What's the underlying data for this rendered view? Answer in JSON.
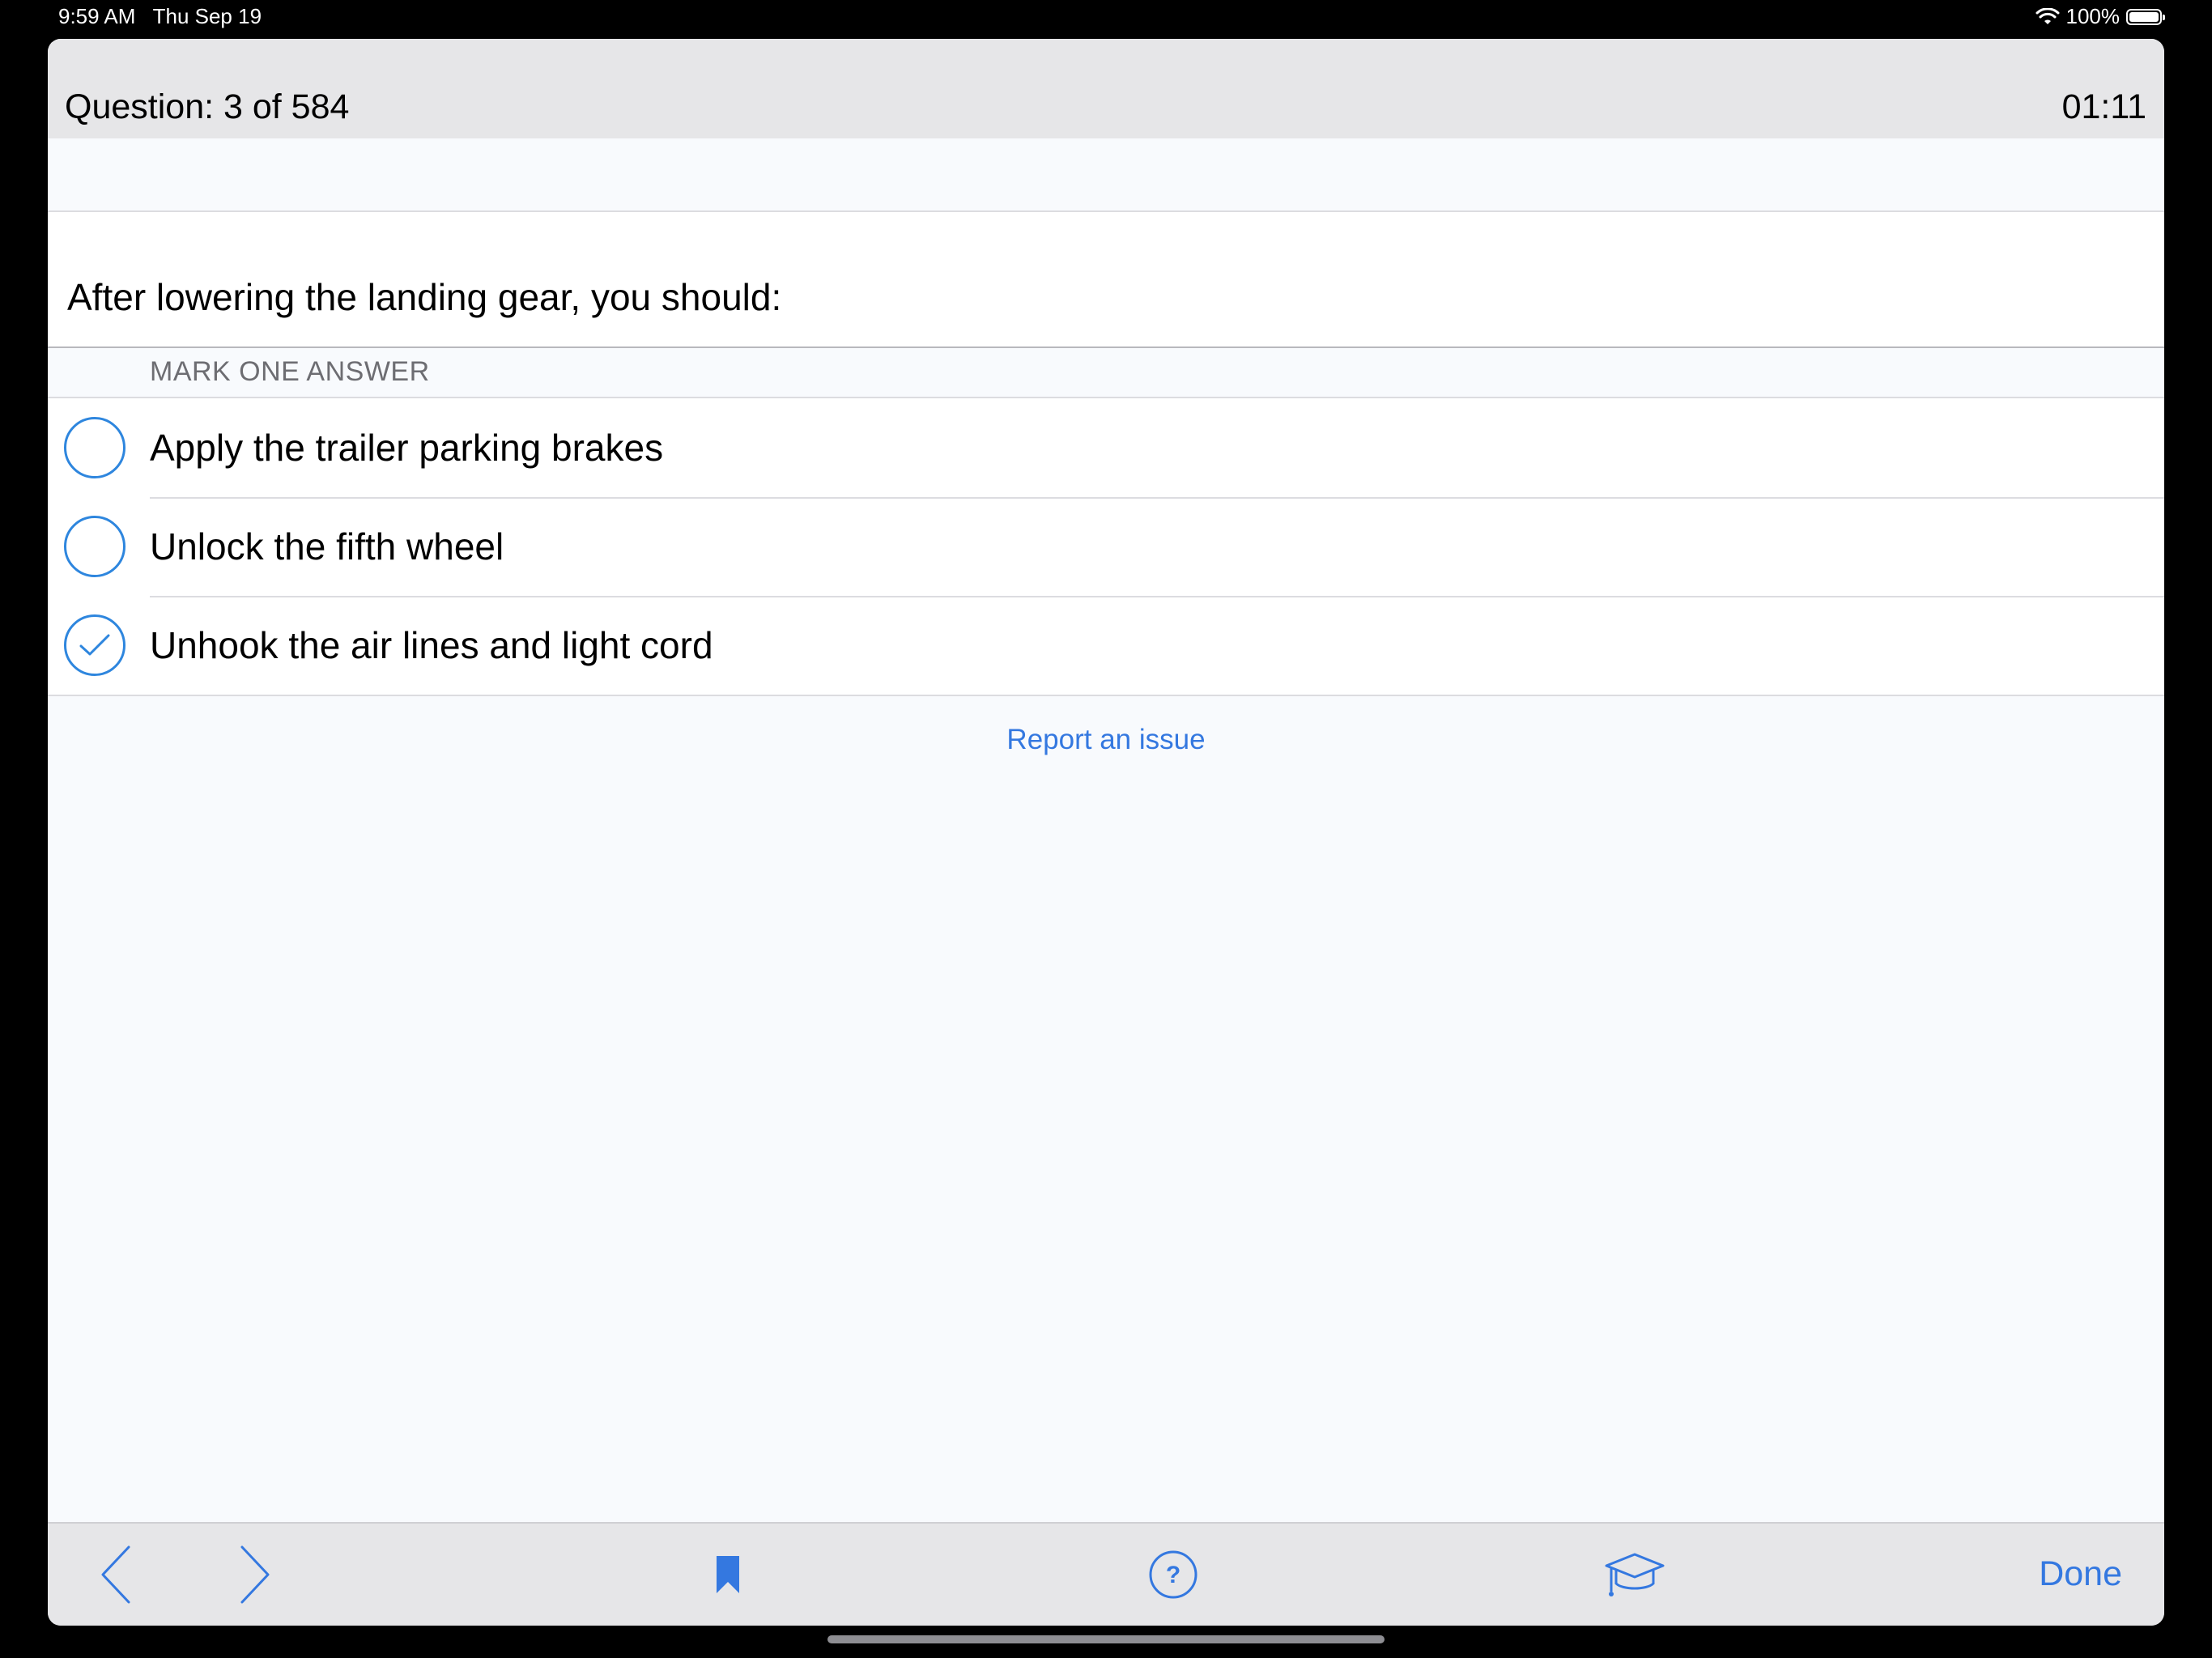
{
  "status_bar": {
    "time": "9:59 AM",
    "date": "Thu Sep 19",
    "battery_text": "100%",
    "wifi_icon": "wifi-icon",
    "battery_icon": "battery-icon"
  },
  "header": {
    "question_counter": "Question: 3 of 584",
    "timer": "01:11"
  },
  "question": {
    "text": "After lowering the landing gear, you should:"
  },
  "answers": {
    "section_label": "MARK ONE ANSWER",
    "options": [
      {
        "label": "Apply the trailer parking brakes",
        "selected": false
      },
      {
        "label": "Unlock the fifth wheel",
        "selected": false
      },
      {
        "label": "Unhook the air lines and light cord",
        "selected": true
      }
    ]
  },
  "report_link": "Report an issue",
  "toolbar": {
    "back_icon": "chevron-left-icon",
    "forward_icon": "chevron-right-icon",
    "bookmark_icon": "bookmark-icon",
    "help_icon": "question-circle-icon",
    "study_icon": "graduation-cap-icon",
    "done_label": "Done"
  },
  "colors": {
    "accent": "#3478e0",
    "radio": "#2e86de",
    "header_bg": "#e6e6e8",
    "page_bg": "#f8fafd"
  }
}
